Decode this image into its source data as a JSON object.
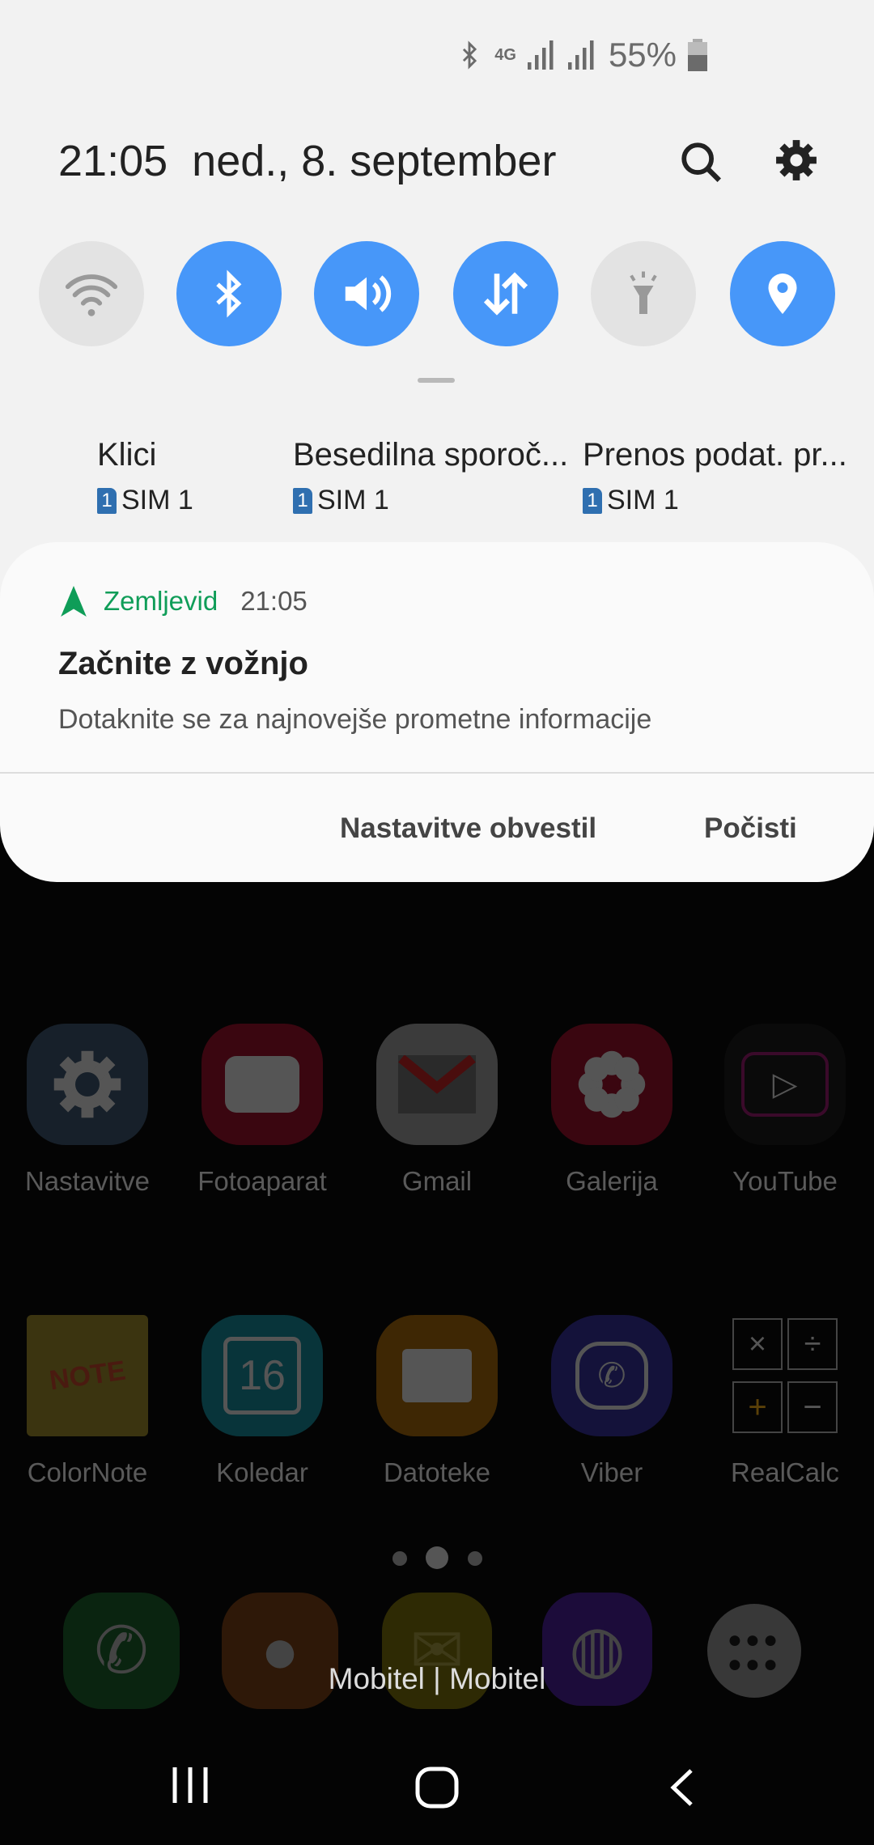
{
  "status_bar": {
    "icons": [
      "bluetooth-icon",
      "4g-data-icon",
      "signal-icon",
      "signal-icon",
      "battery-icon"
    ],
    "network": "4G",
    "battery": "55%"
  },
  "header": {
    "time": "21:05",
    "date": "ned., 8. september"
  },
  "quick_toggles": [
    {
      "name": "wifi",
      "state": "off"
    },
    {
      "name": "bluetooth",
      "state": "on"
    },
    {
      "name": "sound",
      "state": "on"
    },
    {
      "name": "mobile-data",
      "state": "on"
    },
    {
      "name": "flashlight",
      "state": "off"
    },
    {
      "name": "location",
      "state": "on"
    }
  ],
  "sim_settings": [
    {
      "label": "Klici",
      "sim": "SIM 1",
      "badge": "1"
    },
    {
      "label": "Besedilna sporoč...",
      "sim": "SIM 1",
      "badge": "1"
    },
    {
      "label": "Prenos podat. pr...",
      "sim": "SIM 1",
      "badge": "1"
    }
  ],
  "notification": {
    "app": "Zemljevid",
    "time": "21:05",
    "title": "Začnite z vožnjo",
    "body": "Dotaknite se za najnovejše prometne informacije",
    "app_color": "#0f9d58"
  },
  "actions": {
    "settings": "Nastavitve obvestil",
    "clear": "Počisti"
  },
  "home": {
    "row1": [
      "Nastavitve",
      "Fotoaparat",
      "Gmail",
      "Galerija",
      "YouTube"
    ],
    "row2": [
      "ColorNote",
      "Koledar",
      "Datoteke",
      "Viber",
      "RealCalc"
    ],
    "carrier": "Mobitel | Mobitel"
  },
  "colors": {
    "accent": "#4797f9",
    "panel": "#f2f2f2"
  }
}
